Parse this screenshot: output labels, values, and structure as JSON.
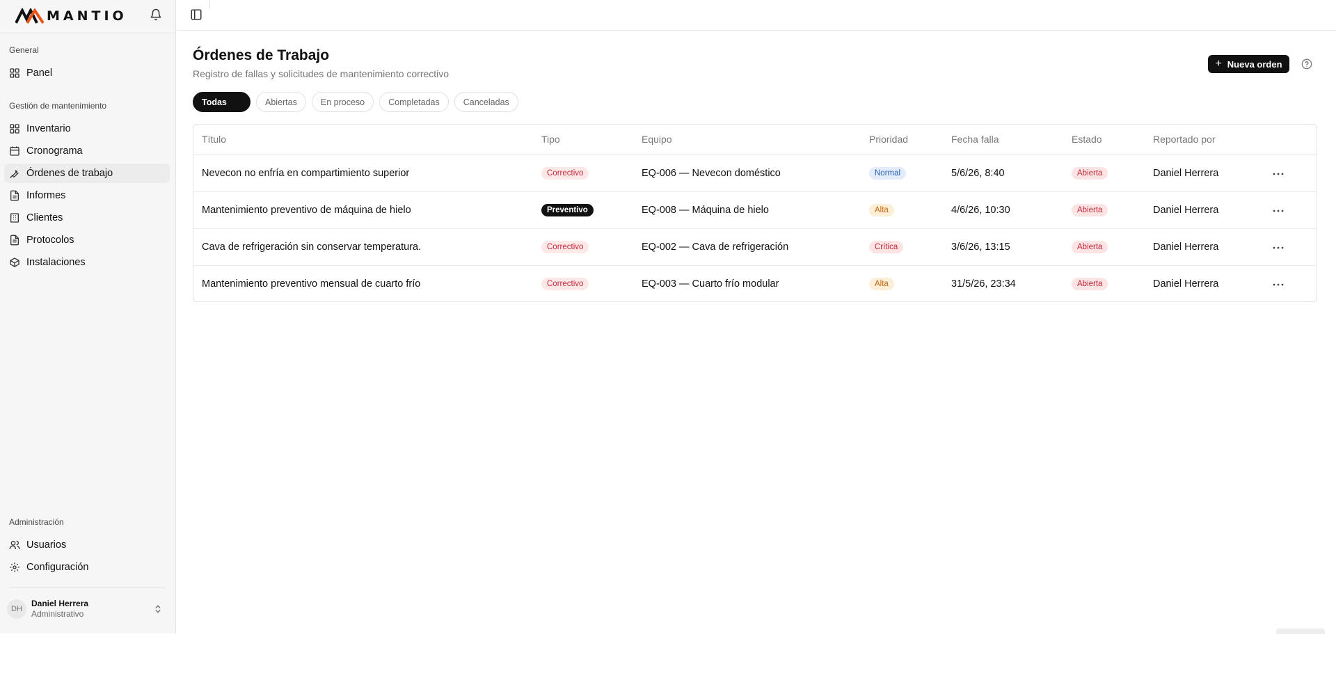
{
  "brand": {
    "name": "MANTIO"
  },
  "sidebar": {
    "sections": [
      {
        "label": "General"
      },
      {
        "label": "Gestión de mantenimiento"
      },
      {
        "label": "Administración"
      }
    ],
    "items": [
      {
        "label": "Panel",
        "icon": "layout-grid-icon"
      },
      {
        "label": "Inventario",
        "icon": "layout-grid-icon"
      },
      {
        "label": "Cronograma",
        "icon": "calendar-icon"
      },
      {
        "label": "Órdenes de trabajo",
        "icon": "wrench-icon"
      },
      {
        "label": "Informes",
        "icon": "file-icon"
      },
      {
        "label": "Clientes",
        "icon": "building-icon"
      },
      {
        "label": "Protocolos",
        "icon": "file-text-icon"
      },
      {
        "label": "Instalaciones",
        "icon": "package-icon"
      },
      {
        "label": "Usuarios",
        "icon": "users-icon"
      },
      {
        "label": "Configuración",
        "icon": "gear-icon"
      }
    ],
    "active_item": "Órdenes de trabajo",
    "user": {
      "initials": "DH",
      "name": "Daniel Herrera",
      "role": "Administrativo"
    }
  },
  "page": {
    "title": "Órdenes de Trabajo",
    "subtitle": "Registro de fallas y solicitudes de mantenimiento correctivo",
    "new_button": "Nueva orden"
  },
  "filters": [
    "Todas",
    "Abiertas",
    "En proceso",
    "Completadas",
    "Canceladas"
  ],
  "active_filter": "Todas",
  "table": {
    "headers": [
      "Título",
      "Tipo",
      "Equipo",
      "Prioridad",
      "Fecha falla",
      "Estado",
      "Reportado por"
    ],
    "rows": [
      {
        "title": "Nevecon no enfría en compartimiento superior",
        "tipo": "Correctivo",
        "equipo": "EQ-006 — Nevecon doméstico",
        "prioridad": "Normal",
        "fecha": "5/6/26, 8:40",
        "estado": "Abierta",
        "reportado": "Daniel Herrera"
      },
      {
        "title": "Mantenimiento preventivo de máquina de hielo",
        "tipo": "Preventivo",
        "equipo": "EQ-008 — Máquina de hielo",
        "prioridad": "Alta",
        "fecha": "4/6/26, 10:30",
        "estado": "Abierta",
        "reportado": "Daniel Herrera"
      },
      {
        "title": "Cava de refrigeración sin conservar temperatura.",
        "tipo": "Correctivo",
        "equipo": "EQ-002 — Cava de refrigeración",
        "prioridad": "Crítica",
        "fecha": "3/6/26, 13:15",
        "estado": "Abierta",
        "reportado": "Daniel Herrera"
      },
      {
        "title": "Mantenimiento preventivo mensual de cuarto frío",
        "tipo": "Correctivo",
        "equipo": "EQ-003 — Cuarto frío modular",
        "prioridad": "Alta",
        "fecha": "31/5/26, 23:34",
        "estado": "Abierta",
        "reportado": "Daniel Herrera"
      }
    ]
  },
  "colors": {
    "primary": "#111111",
    "danger": "#c4263a",
    "warning": "#c26a12",
    "info": "#2a5fb5",
    "sidebar_bg": "#f6f6f6"
  }
}
